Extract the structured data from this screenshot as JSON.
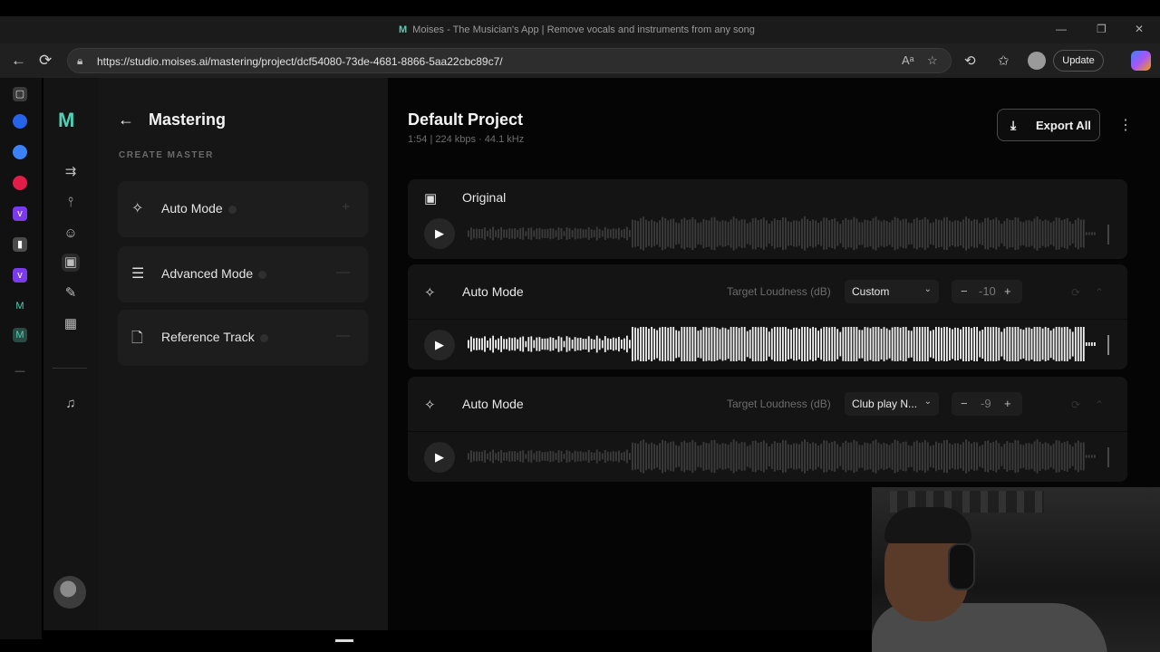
{
  "browser": {
    "title": "Moises - The Musician's App | Remove vocals and instruments from any song",
    "url": "https://studio.moises.ai/mastering/project/dcf54080-73de-4681-8866-5aa22cbc89c7/",
    "update_label": "Update"
  },
  "panel": {
    "title": "Mastering",
    "section": "CREATE MASTER",
    "modes": [
      {
        "label": "Auto Mode",
        "icon": "sparkle-icon",
        "action": "+"
      },
      {
        "label": "Advanced Mode",
        "icon": "sliders-icon",
        "action": "—"
      },
      {
        "label": "Reference Track",
        "icon": "file-icon",
        "action": "—"
      }
    ]
  },
  "main": {
    "project_title": "Default Project",
    "meta": "1:54 | 224 kbps · 44.1 kHz",
    "export_label": "Export All",
    "tracks": [
      {
        "label": "Original",
        "icon": "speaker-icon"
      },
      {
        "label": "Auto Mode",
        "icon": "sparkle-icon",
        "target_label": "Target Loudness (dB)",
        "preset": "Custom",
        "value": "-10"
      },
      {
        "label": "Auto Mode",
        "icon": "sparkle-icon",
        "target_label": "Target Loudness (dB)",
        "preset": "Club play N...",
        "value": "-9"
      }
    ]
  },
  "colors": {
    "accent": "#4fd1b5",
    "background": "#050505",
    "card": "#141414"
  }
}
